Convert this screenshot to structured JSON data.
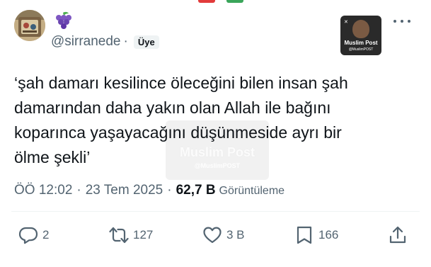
{
  "author": {
    "handle": "@sirranede",
    "separator": "·",
    "badge": "Üye",
    "name_emoji_icon": "grapes-icon"
  },
  "brand": {
    "name": "Muslim Post",
    "handle": "@MuslimPOST"
  },
  "tweet": {
    "text": "‘şah damarı kesilince öleceğini bilen insan şah\ndamarından daha yakın olan Allah ile bağını\nkoparınca yaşayacağını düşünmeside ayrı bir\nölme şekli’"
  },
  "meta": {
    "time": "ÖÖ 12:02",
    "dot1": "·",
    "date": "23 Tem 2025",
    "dot2": "·",
    "views_count": "62,7 B",
    "views_label": "Görüntüleme"
  },
  "actions": {
    "replies": "2",
    "reposts": "127",
    "likes": "3 B",
    "bookmarks": "166"
  },
  "colors": {
    "text": "#0f1419",
    "muted": "#536471",
    "divider": "#eff3f4"
  }
}
